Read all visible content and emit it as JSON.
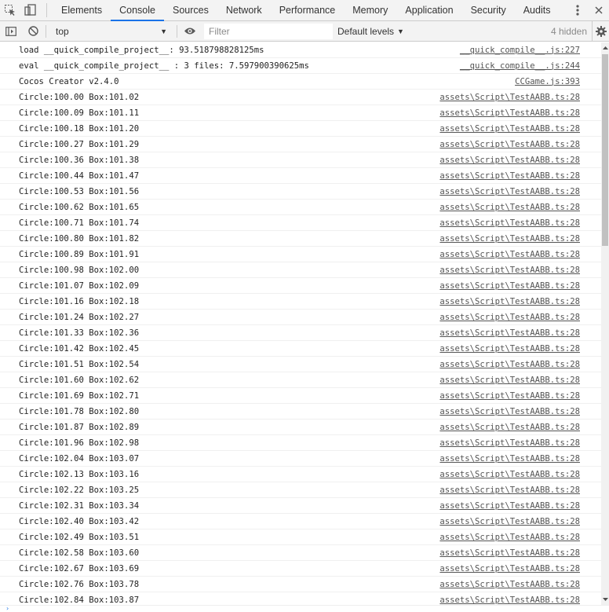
{
  "tabs": [
    {
      "label": "Elements",
      "active": false
    },
    {
      "label": "Console",
      "active": true
    },
    {
      "label": "Sources",
      "active": false
    },
    {
      "label": "Network",
      "active": false
    },
    {
      "label": "Performance",
      "active": false
    },
    {
      "label": "Memory",
      "active": false
    },
    {
      "label": "Application",
      "active": false
    },
    {
      "label": "Security",
      "active": false
    },
    {
      "label": "Audits",
      "active": false
    }
  ],
  "toolbar": {
    "context": "top",
    "filter_placeholder": "Filter",
    "levels": "Default levels",
    "hidden": "4 hidden"
  },
  "icons": {
    "select": "inspect-element-icon",
    "device": "device-toolbar-icon",
    "sidebar": "sidebar-toggle-icon",
    "clear": "clear-console-icon",
    "eye": "live-expression-eye-icon",
    "gear": "settings-gear-icon",
    "kebab": "more-options-icon",
    "close": "close-icon"
  },
  "colors": {
    "accent": "#1a73e8",
    "link": "#545454"
  },
  "messages": [
    {
      "text": "load __quick_compile_project__: 93.518798828125ms",
      "source": "__quick_compile__.js:227"
    },
    {
      "text": "eval __quick_compile_project__ : 3 files: 7.597900390625ms",
      "source": "__quick_compile__.js:244"
    },
    {
      "text": "Cocos Creator v2.4.0",
      "source": "CCGame.js:393"
    },
    {
      "text": "Circle:100.00 Box:101.02",
      "source": "assets\\Script\\TestAABB.ts:28"
    },
    {
      "text": "Circle:100.09 Box:101.11",
      "source": "assets\\Script\\TestAABB.ts:28"
    },
    {
      "text": "Circle:100.18 Box:101.20",
      "source": "assets\\Script\\TestAABB.ts:28"
    },
    {
      "text": "Circle:100.27 Box:101.29",
      "source": "assets\\Script\\TestAABB.ts:28"
    },
    {
      "text": "Circle:100.36 Box:101.38",
      "source": "assets\\Script\\TestAABB.ts:28"
    },
    {
      "text": "Circle:100.44 Box:101.47",
      "source": "assets\\Script\\TestAABB.ts:28"
    },
    {
      "text": "Circle:100.53 Box:101.56",
      "source": "assets\\Script\\TestAABB.ts:28"
    },
    {
      "text": "Circle:100.62 Box:101.65",
      "source": "assets\\Script\\TestAABB.ts:28"
    },
    {
      "text": "Circle:100.71 Box:101.74",
      "source": "assets\\Script\\TestAABB.ts:28"
    },
    {
      "text": "Circle:100.80 Box:101.82",
      "source": "assets\\Script\\TestAABB.ts:28"
    },
    {
      "text": "Circle:100.89 Box:101.91",
      "source": "assets\\Script\\TestAABB.ts:28"
    },
    {
      "text": "Circle:100.98 Box:102.00",
      "source": "assets\\Script\\TestAABB.ts:28"
    },
    {
      "text": "Circle:101.07 Box:102.09",
      "source": "assets\\Script\\TestAABB.ts:28"
    },
    {
      "text": "Circle:101.16 Box:102.18",
      "source": "assets\\Script\\TestAABB.ts:28"
    },
    {
      "text": "Circle:101.24 Box:102.27",
      "source": "assets\\Script\\TestAABB.ts:28"
    },
    {
      "text": "Circle:101.33 Box:102.36",
      "source": "assets\\Script\\TestAABB.ts:28"
    },
    {
      "text": "Circle:101.42 Box:102.45",
      "source": "assets\\Script\\TestAABB.ts:28"
    },
    {
      "text": "Circle:101.51 Box:102.54",
      "source": "assets\\Script\\TestAABB.ts:28"
    },
    {
      "text": "Circle:101.60 Box:102.62",
      "source": "assets\\Script\\TestAABB.ts:28"
    },
    {
      "text": "Circle:101.69 Box:102.71",
      "source": "assets\\Script\\TestAABB.ts:28"
    },
    {
      "text": "Circle:101.78 Box:102.80",
      "source": "assets\\Script\\TestAABB.ts:28"
    },
    {
      "text": "Circle:101.87 Box:102.89",
      "source": "assets\\Script\\TestAABB.ts:28"
    },
    {
      "text": "Circle:101.96 Box:102.98",
      "source": "assets\\Script\\TestAABB.ts:28"
    },
    {
      "text": "Circle:102.04 Box:103.07",
      "source": "assets\\Script\\TestAABB.ts:28"
    },
    {
      "text": "Circle:102.13 Box:103.16",
      "source": "assets\\Script\\TestAABB.ts:28"
    },
    {
      "text": "Circle:102.22 Box:103.25",
      "source": "assets\\Script\\TestAABB.ts:28"
    },
    {
      "text": "Circle:102.31 Box:103.34",
      "source": "assets\\Script\\TestAABB.ts:28"
    },
    {
      "text": "Circle:102.40 Box:103.42",
      "source": "assets\\Script\\TestAABB.ts:28"
    },
    {
      "text": "Circle:102.49 Box:103.51",
      "source": "assets\\Script\\TestAABB.ts:28"
    },
    {
      "text": "Circle:102.58 Box:103.60",
      "source": "assets\\Script\\TestAABB.ts:28"
    },
    {
      "text": "Circle:102.67 Box:103.69",
      "source": "assets\\Script\\TestAABB.ts:28"
    },
    {
      "text": "Circle:102.76 Box:103.78",
      "source": "assets\\Script\\TestAABB.ts:28"
    },
    {
      "text": "Circle:102.84 Box:103.87",
      "source": "assets\\Script\\TestAABB.ts:28"
    }
  ]
}
